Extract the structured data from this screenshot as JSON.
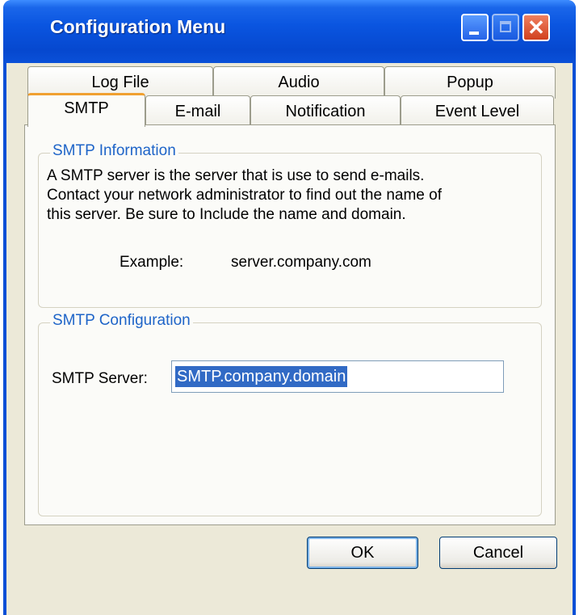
{
  "window": {
    "title": "Configuration Menu",
    "minimize_icon": "minimize-icon",
    "maximize_icon": "maximize-icon",
    "close_icon": "close-icon",
    "close_glyph": "✕"
  },
  "tabs": {
    "row_back": [
      {
        "label": "Log File"
      },
      {
        "label": "Audio"
      },
      {
        "label": "Popup"
      }
    ],
    "row_front": [
      {
        "label": "SMTP",
        "selected": true
      },
      {
        "label": "E-mail"
      },
      {
        "label": "Notification"
      },
      {
        "label": "Event Level"
      }
    ]
  },
  "smtp_info": {
    "legend": "SMTP Information",
    "line1": "A SMTP server is the server that is use to send e-mails.",
    "line2": "Contact your network administrator to find out the name of",
    "line3": "this server. Be sure to Include the name and domain.",
    "example_label": "Example:",
    "example_value": "server.company.com"
  },
  "smtp_config": {
    "legend": "SMTP Configuration",
    "server_label": "SMTP Server:",
    "server_value": "SMTP.company.domain"
  },
  "buttons": {
    "ok": "OK",
    "cancel": "Cancel"
  },
  "colors": {
    "title_bar": "#0a55e0",
    "selected_tab_accent": "#f0a030",
    "legend_text": "#1e64c8",
    "selection": "#316ac5"
  }
}
